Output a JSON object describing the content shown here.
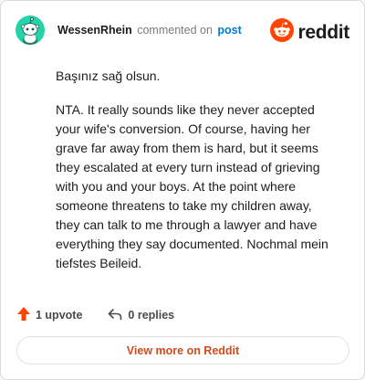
{
  "header": {
    "username": "WessenRhein",
    "verb": "commented on",
    "post_link": "post",
    "brand": "reddit"
  },
  "comment": {
    "paragraphs": [
      "Başınız sağ olsun.",
      "NTA. It really sounds like they never accepted your wife's conversion. Of course, having her grave far away from them is hard, but it seems they escalated at every turn instead of grieving with you and your boys. At the point where someone threatens to take my children away, they can talk to me through a lawyer and have everything they say documented. Nochmal mein tiefstes Beileid."
    ]
  },
  "footer": {
    "upvotes": "1 upvote",
    "replies": "0 replies"
  },
  "cta": {
    "label": "View more on Reddit"
  },
  "colors": {
    "avatar_bg": "#24d3a9",
    "reddit_orange": "#ff4500",
    "link_blue": "#0079d3",
    "cta_text": "#d24b1c"
  },
  "icons": {
    "avatar": "snoo-avatar-icon",
    "brand": "reddit-logo-icon",
    "upvote": "upvote-arrow-icon",
    "reply": "reply-arrow-icon"
  }
}
